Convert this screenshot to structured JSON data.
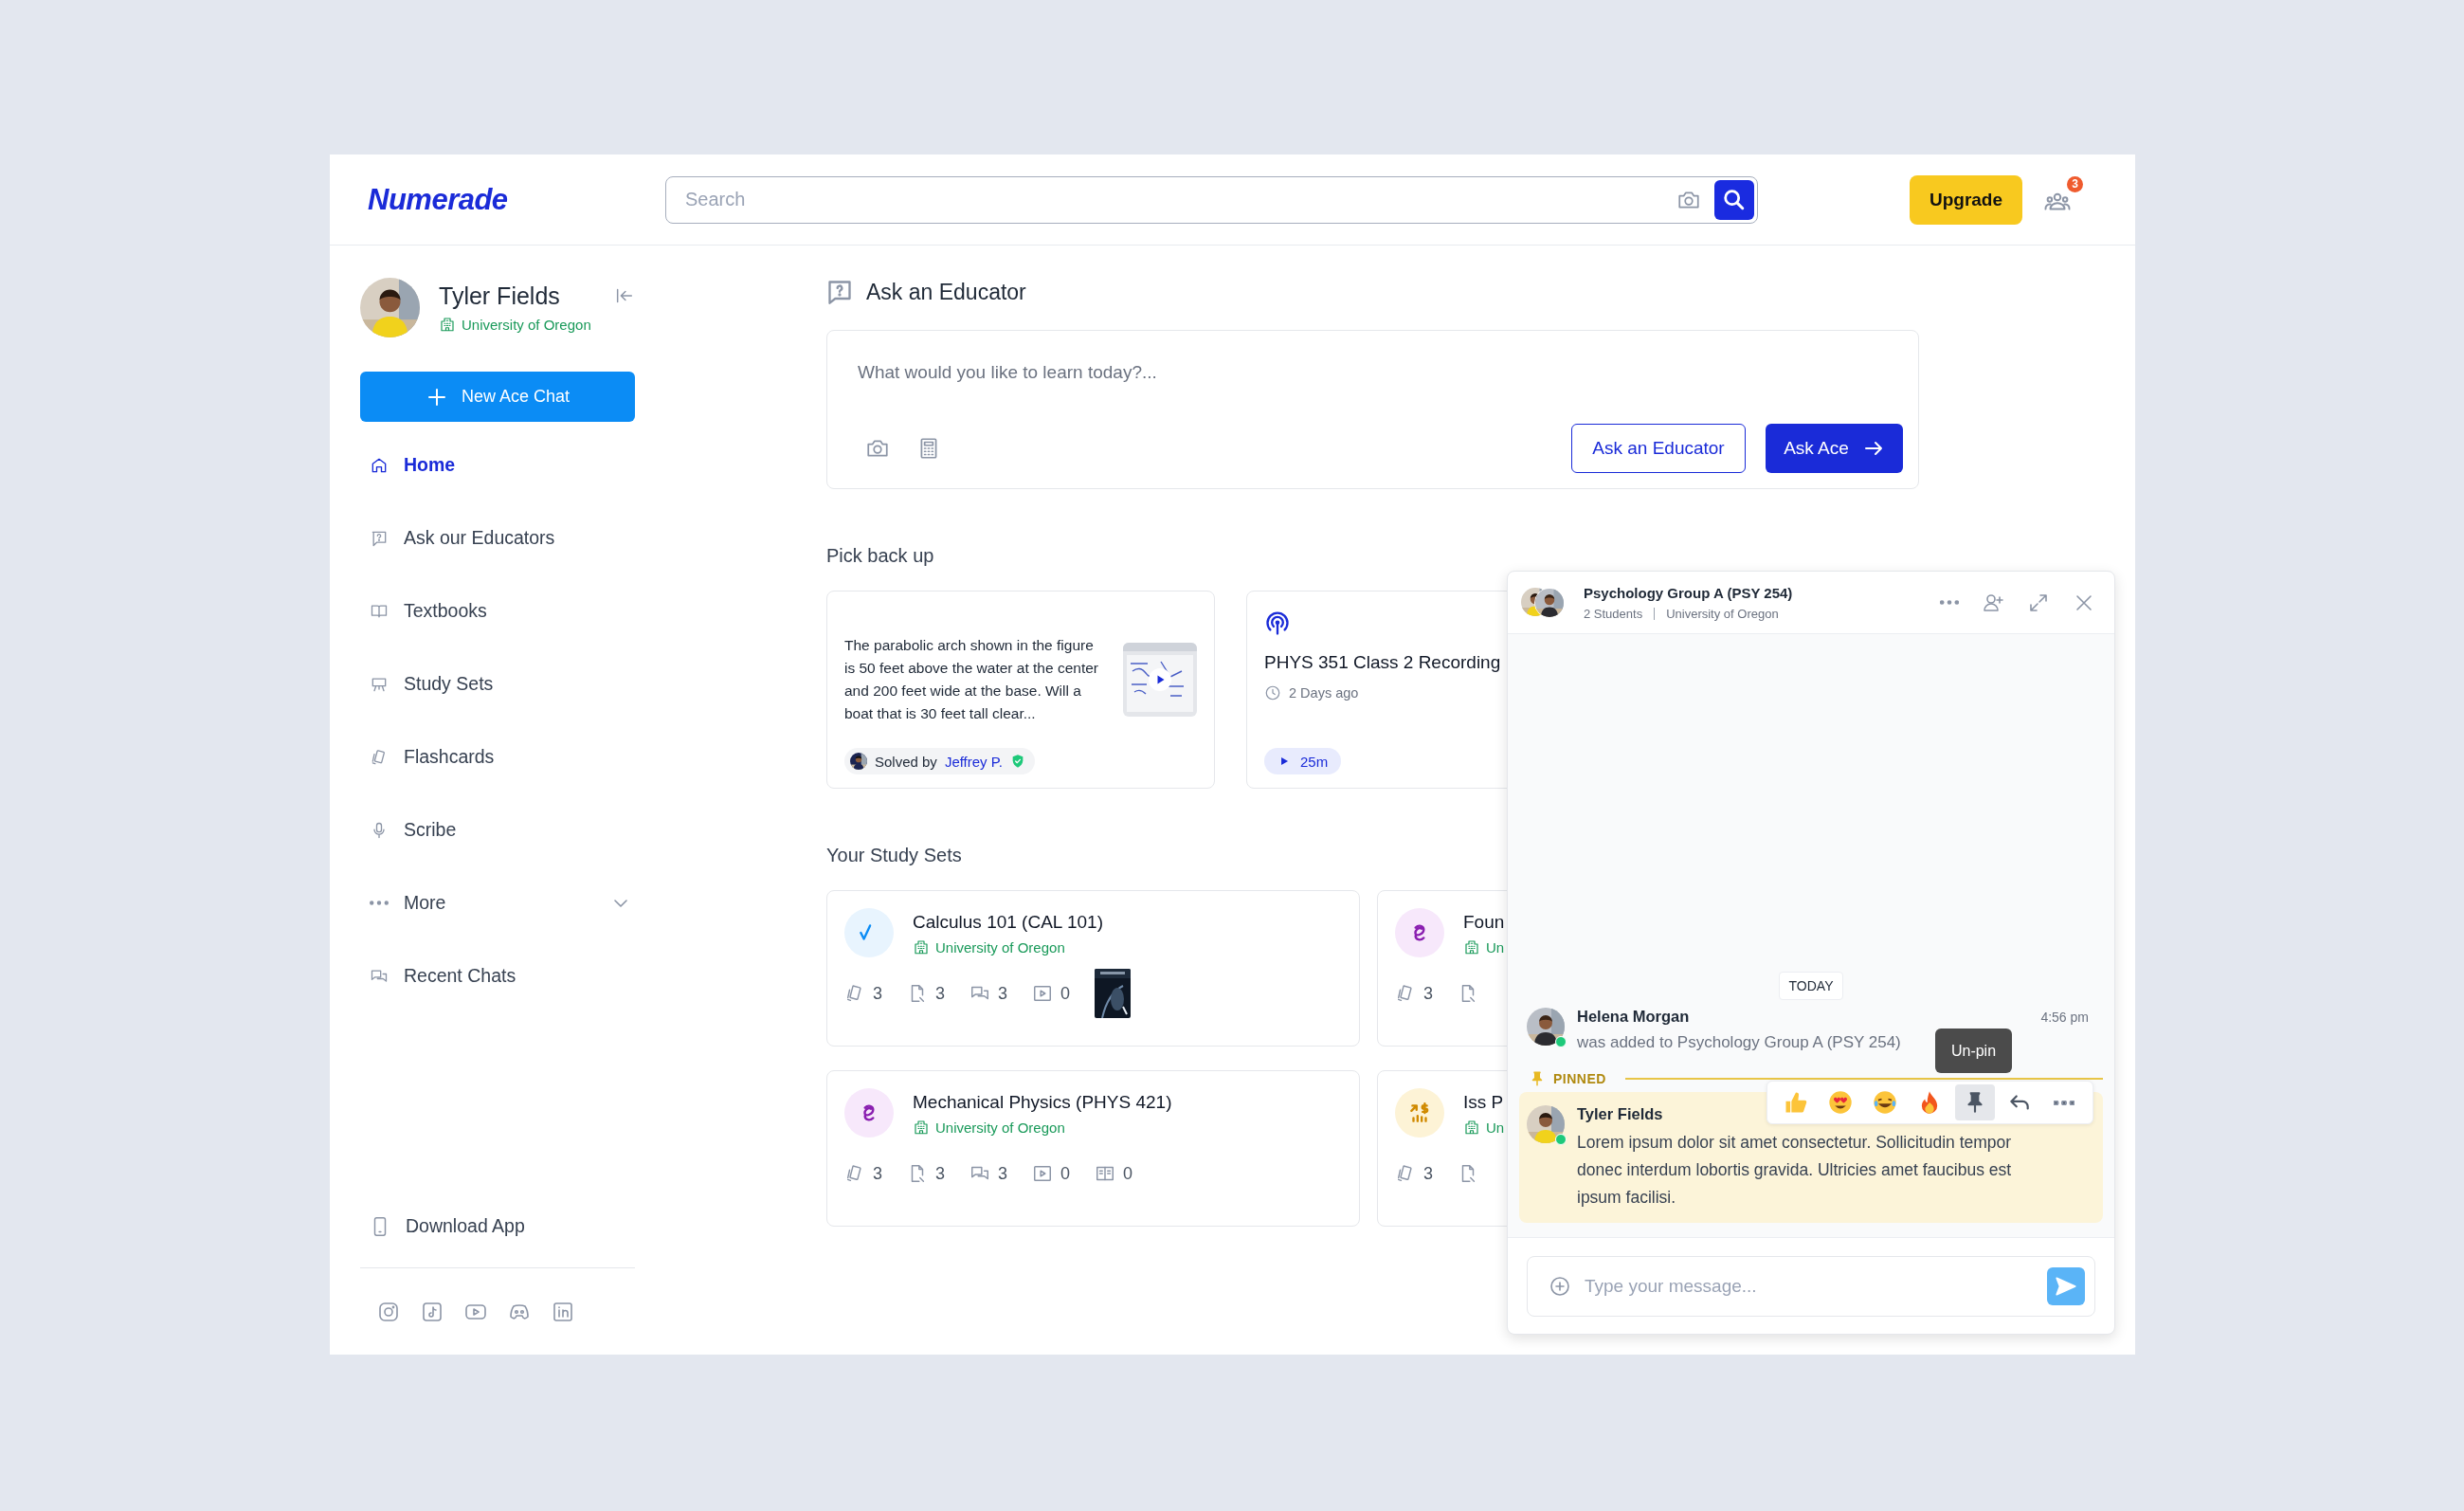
{
  "header": {
    "logo": "Numerade",
    "search": {
      "placeholder": "Search"
    },
    "upgrade_button": "Upgrade",
    "notification_count": "3"
  },
  "sidebar": {
    "profile": {
      "name": "Tyler Fields",
      "school": "University of Oregon"
    },
    "new_chat_button": "New Ace Chat",
    "items": [
      {
        "label": "Home",
        "kind": "link",
        "selected": true
      },
      {
        "label": "Ask our Educators",
        "kind": "link",
        "selected": false
      },
      {
        "label": "Textbooks",
        "kind": "link",
        "selected": false
      },
      {
        "label": "Study Sets",
        "kind": "link",
        "selected": false
      },
      {
        "label": "Flashcards",
        "kind": "link",
        "selected": false
      },
      {
        "label": "Scribe",
        "kind": "link",
        "selected": false
      },
      {
        "label": "More",
        "kind": "expander",
        "selected": false
      },
      {
        "label": "Recent Chats",
        "kind": "link",
        "selected": false
      }
    ],
    "download_app": "Download App"
  },
  "ask_section": {
    "title": "Ask an Educator",
    "placeholder": "What would you like to learn today?...",
    "educator_button": "Ask an Educator",
    "ace_button": "Ask Ace"
  },
  "pick_back_up": {
    "title": "Pick back up",
    "cards": [
      {
        "kind": "question",
        "text": "The parabolic arch shown in the figure is 50 feet above the water at the center and 200 feet wide at the base. Will a boat that is 30 feet tall clear...",
        "solved_by": "Solved by",
        "solver": "Jeffrey P."
      },
      {
        "kind": "recording",
        "title": "PHYS 351 Class 2 Recording",
        "time": "2 Days ago",
        "duration": "25m"
      }
    ]
  },
  "study_sets": {
    "title": "Your Study Sets",
    "sets": [
      {
        "kind": "math",
        "title": "Calculus 101 (CAL 101)",
        "school": "University of Oregon",
        "cover": {
          "kind": "picture"
        },
        "stats": [
          {
            "kind": "flashcards",
            "count": "3"
          },
          {
            "kind": "notes",
            "count": "3"
          },
          {
            "kind": "chats",
            "count": "3"
          },
          {
            "kind": "videos",
            "count": "0"
          }
        ]
      },
      {
        "kind": "physics",
        "title": "Foun",
        "school": "Un",
        "stats": [
          {
            "kind": "flashcards",
            "count": "3"
          },
          {
            "kind": "notes"
          }
        ]
      },
      {
        "kind": "physics",
        "title": "Mechanical Physics (PHYS 421)",
        "school": "University of Oregon",
        "stats": [
          {
            "kind": "flashcards",
            "count": "3"
          },
          {
            "kind": "notes",
            "count": "3"
          },
          {
            "kind": "chats",
            "count": "3"
          },
          {
            "kind": "videos",
            "count": "0"
          },
          {
            "kind": "textbooks",
            "count": "0"
          }
        ]
      },
      {
        "kind": "finance",
        "title": "Iss P",
        "school": "Un",
        "stats": [
          {
            "kind": "flashcards",
            "count": "3"
          },
          {
            "kind": "notes"
          }
        ]
      }
    ]
  },
  "chat": {
    "title": "Psychology Group A (PSY 254)",
    "members": "2 Students",
    "school": "University of Oregon",
    "date_divider": "TODAY",
    "pinned_label": "PINNED",
    "tooltip": "Un-pin",
    "messages": [
      {
        "kind": "event",
        "author": "Helena Morgan",
        "time": "4:56 pm",
        "text": "was added to Psychology Group A (PSY 254)",
        "online": true
      },
      {
        "kind": "pinned",
        "author": "Tyler Fields",
        "text": "Lorem ipsum dolor sit amet consectetur. Sollicitudin tempor donec interdum lobortis gravida. Ultricies amet faucibus est ipsum facilisi.",
        "online": true
      }
    ],
    "input": {
      "placeholder": "Type your message..."
    }
  }
}
